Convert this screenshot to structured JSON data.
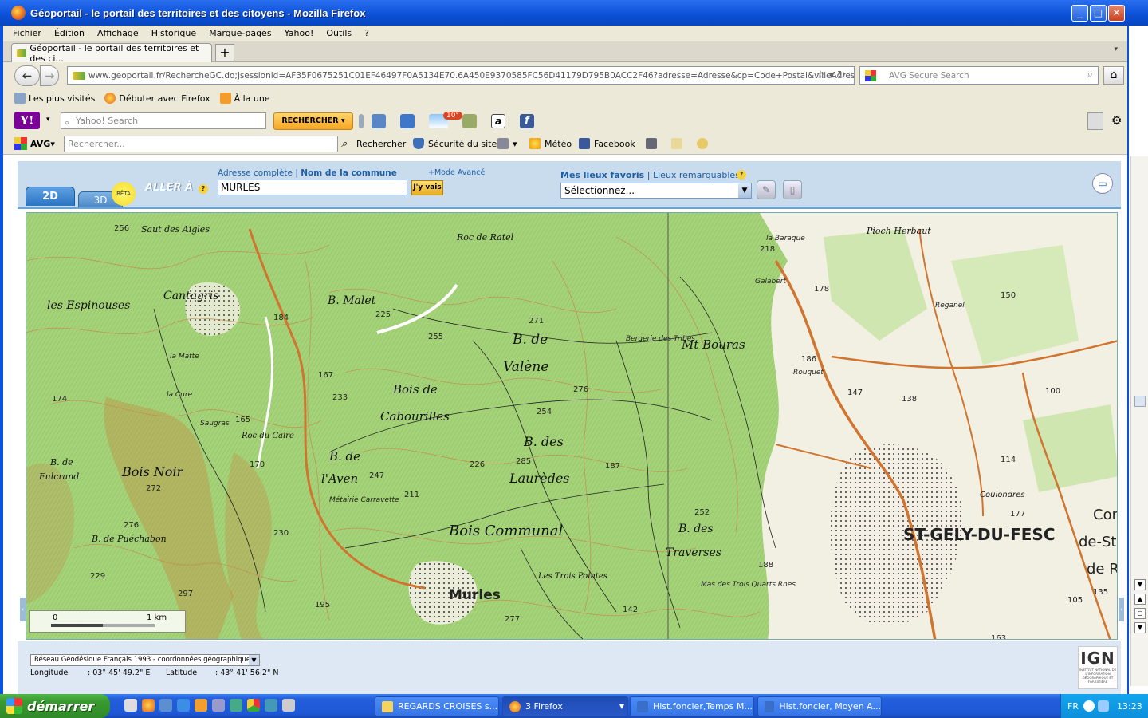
{
  "window": {
    "title": "Géoportail - le portail des territoires et des citoyens - Mozilla Firefox",
    "minimize": "_",
    "maximize": "□",
    "close": "✕"
  },
  "menu": [
    "Fichier",
    "Édition",
    "Affichage",
    "Historique",
    "Marque-pages",
    "Yahoo!",
    "Outils",
    "?"
  ],
  "tab": {
    "label": "Géoportail - le portail des territoires et des ci...",
    "new_tab": "+"
  },
  "nav": {
    "back": "←",
    "forward": "→",
    "url_host": "www.geoportail.fr",
    "url_path": "/RechercheGC.do;jsessionid=AF35F0675251C01EF46497F0A5134E70.6A450E9370585FC56D41179D795B0ACC2F46?adresse=Adresse&cp=Code+Postal&villeAdresse=",
    "search_placeholder": "AVG Secure Search"
  },
  "bookmarks": [
    "Les plus visités",
    "Débuter avec Firefox",
    "À la une"
  ],
  "yahoo_toolbar": {
    "logo": "Y!",
    "search_placeholder": "Yahoo! Search",
    "search_button": "RECHERCHER",
    "temperature": "10°"
  },
  "avg_toolbar": {
    "logo": "AVG",
    "search_placeholder": "Rechercher...",
    "items": [
      "Rechercher",
      "Sécurité du site",
      "Météo",
      "Facebook"
    ]
  },
  "geoportail": {
    "tab_2d": "2D",
    "tab_3d": "3D",
    "beta": "BÊTA",
    "aller_a": "ALLER À",
    "help": "?",
    "adr_complete": "Adresse complète",
    "adr_sep": " | ",
    "nom_commune": "Nom de la commune",
    "mode_avance": "+Mode Avancé",
    "search_value": "MURLES",
    "go_button": "J'y vais",
    "mes_lieux": "Mes lieux favoris",
    "lieux_remarquables": "Lieux remarquables",
    "select_value": "Sélectionnez..."
  },
  "map": {
    "labels": [
      "Saut des Aigles",
      "les Espinouses",
      "Cantagris",
      "B. Malet",
      "Roc de Ratel",
      "B. de",
      "Valène",
      "Bois de",
      "Cabourilles",
      "Mt Bouras",
      "Bergerie des Tribes",
      "B. de",
      "Fulcrand",
      "Bois Noir",
      "B. de",
      "l'Aven",
      "B. des",
      "Laurèdes",
      "Bois Communal",
      "B. des",
      "Traverses",
      "Murles",
      "B. de Puéchabon",
      "ST-GELY-DU-FESC",
      "Pioch Herbaut",
      "Reganel",
      "la Baraque",
      "Galabert",
      "Rouquet",
      "Coulondres",
      "Les Trois Pointes",
      "Mas des Trois Quarts Rnes",
      "Métairie Carravette",
      "Saugras",
      "la Cure",
      "la Matte",
      "Roc du Caire",
      "Com",
      "de-St-",
      "de R"
    ],
    "spot_heights": [
      "256",
      "174",
      "272",
      "276",
      "229",
      "297",
      "225",
      "255",
      "271",
      "276",
      "254",
      "233",
      "167",
      "165",
      "170",
      "247",
      "211",
      "226",
      "187",
      "252",
      "230",
      "195",
      "218",
      "178",
      "186",
      "147",
      "138",
      "150",
      "100",
      "114",
      "177",
      "135",
      "105",
      "163",
      "188",
      "142",
      "277",
      "184",
      "285"
    ],
    "scale_zero": "0",
    "scale_km": "1 km",
    "side_left": "‹",
    "side_right": "›"
  },
  "coordbar": {
    "projection": "Réseau Géodésique Français 1993 - coordonnées géographiques",
    "longitude_label": "Longitude",
    "longitude_value": ": 03° 45' 49.2\" E",
    "latitude_label": "Latitude",
    "latitude_value": ": 43° 41' 56.2\" N",
    "ign": "IGN",
    "ign_sub": "INSTITUT NATIONAL DE L'INFORMATION GÉOGRAPHIQUE ET FORESTIÈRE"
  },
  "taskbar": {
    "start": "démarrer",
    "tasks": [
      "REGARDS CROISES s...",
      "3 Firefox",
      "Hist.foncier,Temps M...",
      "Hist.foncier, Moyen A..."
    ],
    "lang": "FR",
    "clock": "13:23"
  }
}
